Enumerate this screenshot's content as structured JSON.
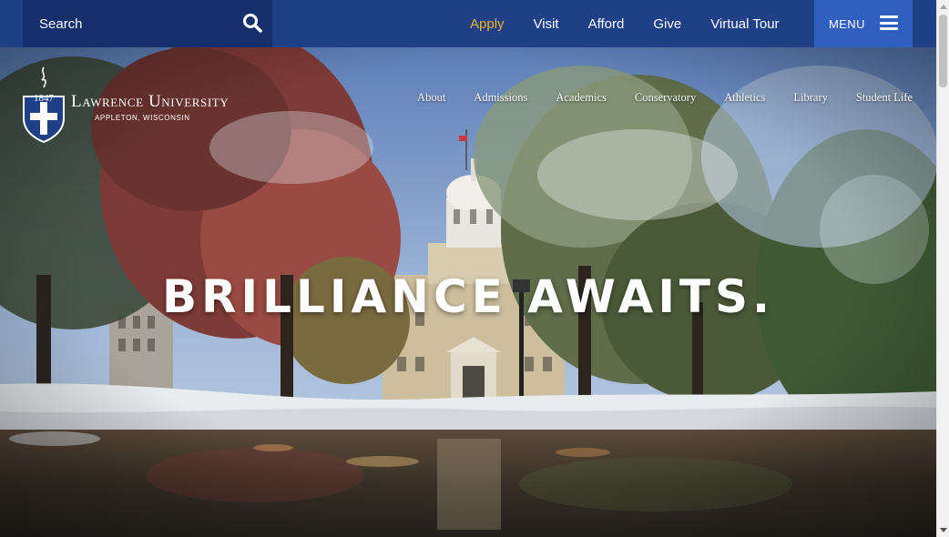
{
  "search": {
    "placeholder": "Search",
    "icon": "search-icon"
  },
  "utility_nav": {
    "items": [
      {
        "label": "Apply",
        "accent": "#f2b51b"
      },
      {
        "label": "Visit"
      },
      {
        "label": "Afford"
      },
      {
        "label": "Give"
      },
      {
        "label": "Virtual Tour"
      }
    ],
    "menu_label": "MENU",
    "menu_icon": "hamburger-icon"
  },
  "logo": {
    "name": "Lawrence University",
    "location": "APPLETON, WISCONSIN",
    "year": "1847"
  },
  "main_nav": {
    "items": [
      {
        "label": "About"
      },
      {
        "label": "Admissions"
      },
      {
        "label": "Academics"
      },
      {
        "label": "Conservatory"
      },
      {
        "label": "Athletics"
      },
      {
        "label": "Library"
      },
      {
        "label": "Student Life"
      }
    ]
  },
  "hero": {
    "headline": "BRILLIANCE AWAITS."
  },
  "colors": {
    "topbar": "#1f3f87",
    "search_bg": "#142f6c",
    "menu_bg": "#2f5fbf",
    "accent": "#f2b51b"
  }
}
